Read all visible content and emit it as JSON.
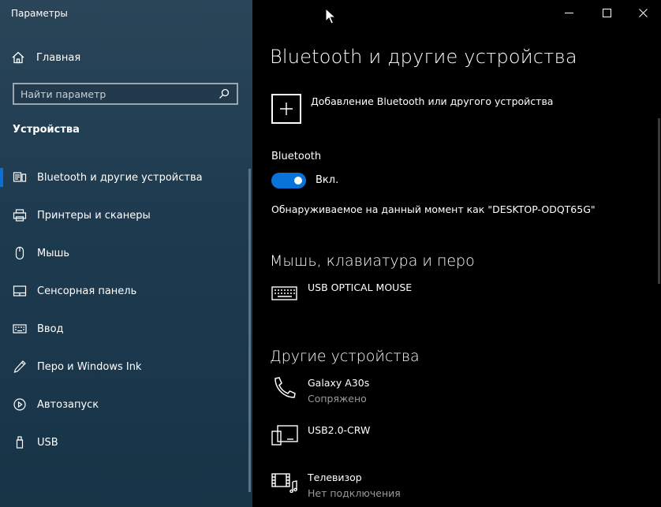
{
  "window": {
    "title": "Параметры"
  },
  "sidebar": {
    "home_label": "Главная",
    "search_placeholder": "Найти параметр",
    "section_title": "Устройства",
    "items": [
      {
        "label": "Bluetooth и другие устройства",
        "icon": "bluetooth-devices-icon",
        "active": true
      },
      {
        "label": "Принтеры и сканеры",
        "icon": "printer-icon"
      },
      {
        "label": "Мышь",
        "icon": "mouse-icon"
      },
      {
        "label": "Сенсорная панель",
        "icon": "touchpad-icon"
      },
      {
        "label": "Ввод",
        "icon": "keyboard-icon"
      },
      {
        "label": "Перо и Windows Ink",
        "icon": "pen-icon"
      },
      {
        "label": "Автозапуск",
        "icon": "autoplay-icon"
      },
      {
        "label": "USB",
        "icon": "usb-icon"
      }
    ]
  },
  "main": {
    "title": "Bluetooth и другие устройства",
    "add_device_label": "Добавление Bluetooth или другого устройства",
    "bluetooth_label": "Bluetooth",
    "toggle_state": "Вкл.",
    "toggle_on": true,
    "discoverable_text": "Обнаруживаемое на данный момент как \"DESKTOP-ODQT65G\"",
    "mouse_section": {
      "title": "Мышь, клавиатура и перо",
      "devices": [
        {
          "name": "USB OPTICAL MOUSE",
          "icon": "keyboard-device-icon"
        }
      ]
    },
    "other_section": {
      "title": "Другие устройства",
      "devices": [
        {
          "name": "Galaxy A30s",
          "status": "Сопряжено",
          "icon": "phone-icon"
        },
        {
          "name": "USB2.0-CRW",
          "icon": "usb-reader-icon"
        },
        {
          "name": "Телевизор",
          "status": "Нет подключения",
          "icon": "media-device-icon"
        }
      ]
    }
  },
  "colors": {
    "accent": "#0a73d9",
    "sidebar_bg": "#1d3a4f",
    "main_bg": "#000000"
  }
}
